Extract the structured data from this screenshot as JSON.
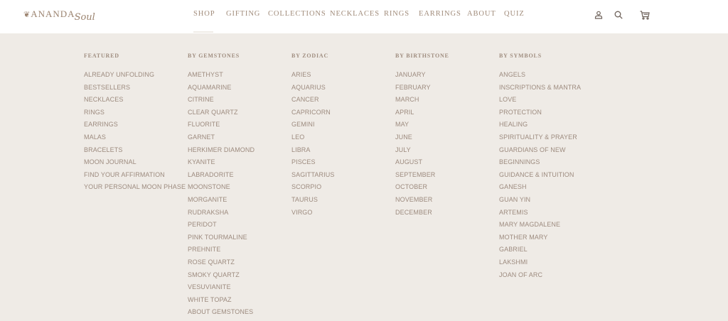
{
  "brand": {
    "ornament": "❦",
    "word": "ANANDA",
    "script": "Soul"
  },
  "nav": {
    "items": [
      "SHOP",
      "GIFTING",
      "COLLECTIONS",
      "NECKLACES",
      "RINGS",
      "EARRINGS",
      "ABOUT",
      "QUIZ"
    ]
  },
  "icons": [
    "account-icon",
    "search-icon",
    "cart-icon"
  ],
  "colors": {
    "nav_text": "#a18c7b",
    "menu_bg": "#efebe6",
    "heading": "#a08e80",
    "link": "#9d8b7f"
  },
  "menu": {
    "columns": [
      {
        "heading": "FEATURED",
        "items": [
          "ALREADY UNFOLDING",
          "BESTSELLERS",
          "NECKLACES",
          "RINGS",
          "EARRINGS",
          "MALAS",
          "BRACELETS",
          "MOON JOURNAL",
          "FIND YOUR AFFIRMATION",
          "YOUR PERSONAL MOON PHASE"
        ]
      },
      {
        "heading": "BY GEMSTONES",
        "items": [
          "AMETHYST",
          "AQUAMARINE",
          "CITRINE",
          "CLEAR QUARTZ",
          "FLUORITE",
          "GARNET",
          "HERKIMER DIAMOND",
          "KYANITE",
          "LABRADORITE",
          "MOONSTONE",
          "MORGANITE",
          "RUDRAKSHA",
          "PERIDOT",
          "PINK TOURMALINE",
          "PREHNITE",
          "ROSE QUARTZ",
          "SMOKY QUARTZ",
          "VESUVIANITE",
          "WHITE TOPAZ",
          "ABOUT GEMSTONES"
        ]
      },
      {
        "heading": "BY ZODIAC",
        "items": [
          "ARIES",
          "AQUARIUS",
          "CANCER",
          "CAPRICORN",
          "GEMINI",
          "LEO",
          "LIBRA",
          "PISCES",
          "SAGITTARIUS",
          "SCORPIO",
          "TAURUS",
          "VIRGO"
        ]
      },
      {
        "heading": "BY BIRTHSTONE",
        "items": [
          "JANUARY",
          "FEBRUARY",
          "MARCH",
          "APRIL",
          "MAY",
          "JUNE",
          "JULY",
          "AUGUST",
          "SEPTEMBER",
          "OCTOBER",
          "NOVEMBER",
          "DECEMBER"
        ]
      },
      {
        "heading": "BY SYMBOLS",
        "items": [
          "ANGELS",
          "INSCRIPTIONS & MANTRA",
          "LOVE",
          "PROTECTION",
          "HEALING",
          "SPIRITUALITY & PRAYER",
          "GUARDIANS OF NEW",
          "BEGINNINGS",
          "GUIDANCE & INTUITION",
          "GANESH",
          "GUAN YIN",
          "ARTEMIS",
          "MARY MAGDALENE",
          "MOTHER MARY",
          "GABRIEL",
          "LAKSHMI",
          "JOAN OF ARC"
        ]
      }
    ]
  }
}
